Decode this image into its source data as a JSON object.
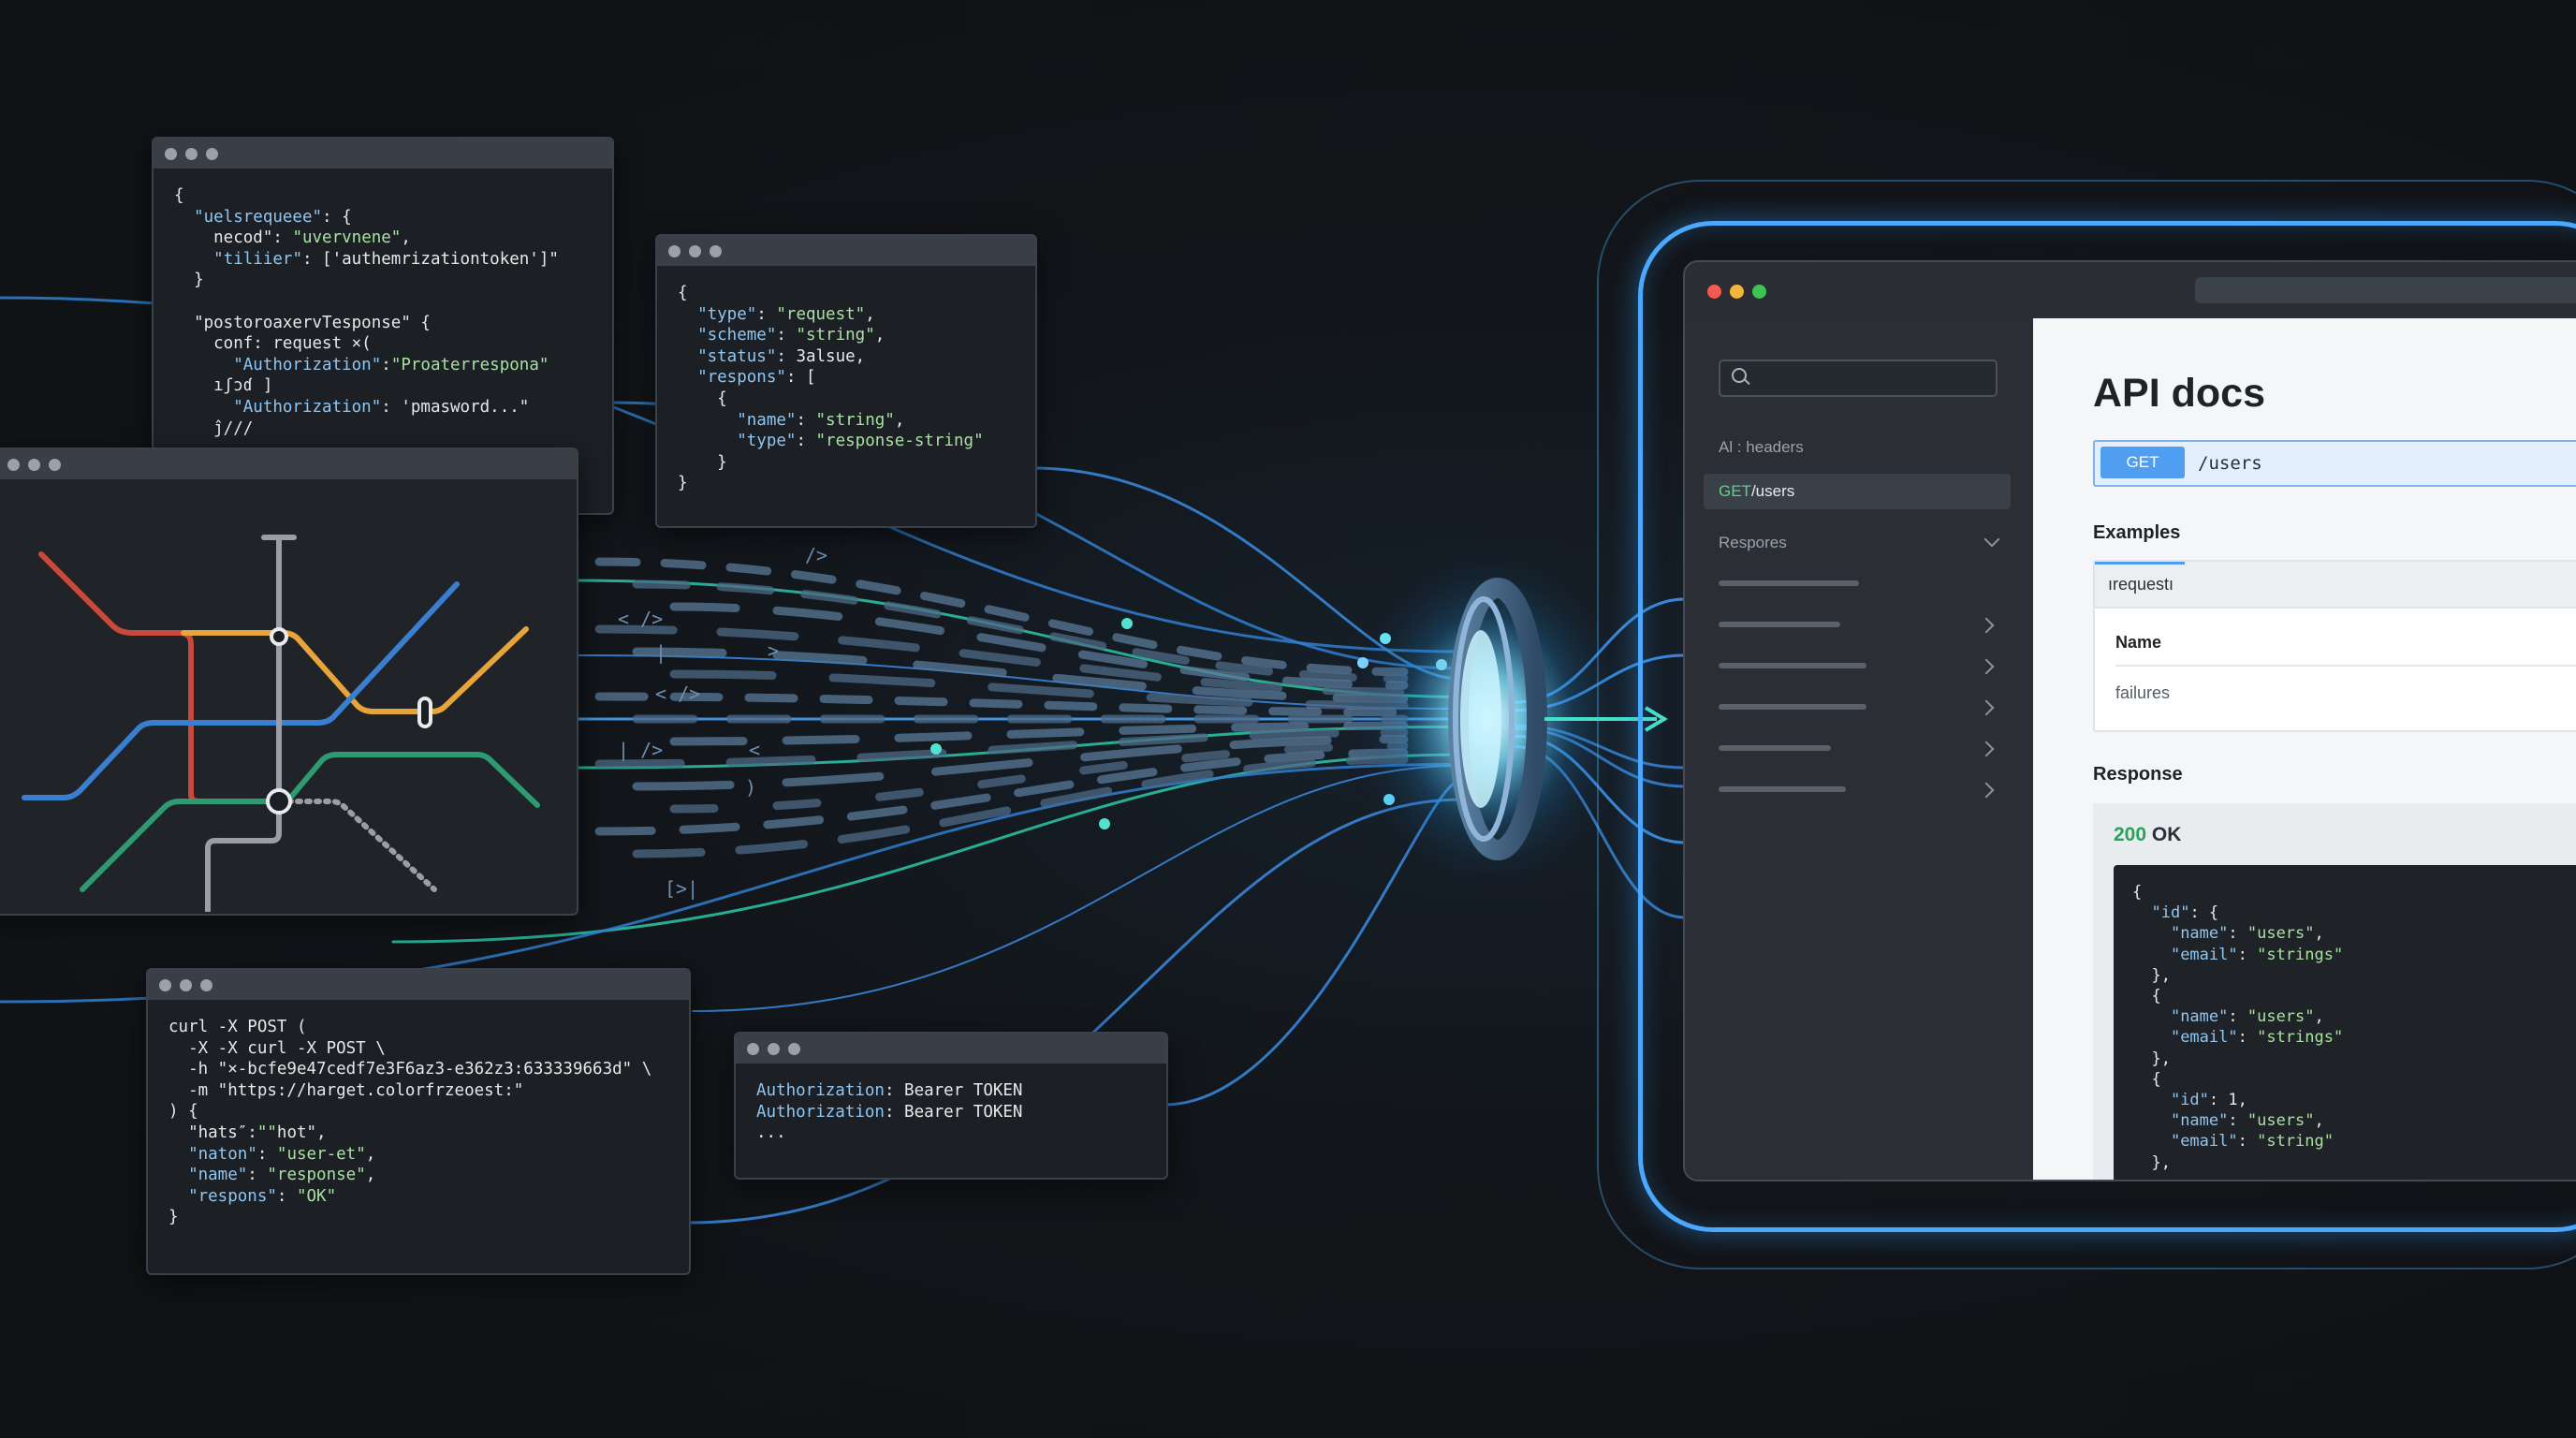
{
  "code_windows": {
    "request_json": [
      "{",
      "  \"uelsrequeee\": {",
      "    necod\": \"uvervnene\",",
      "    \"tiliier\": ['authemrizationtoken']\"",
      "  }",
      "",
      "  \"postoroaxervTesponse\" {",
      "    conf: request ×(",
      "      \"Authorization\":\"Proaterrespona\"",
      "    ıʃɔɗ ]",
      "      \"Authorization\": 'pmasword...\"",
      "    ĵ///"
    ],
    "type_json": [
      "{",
      "  \"type\": \"request\",",
      "  \"scheme\": \"string\",",
      "  \"status\": 3alsue,",
      "  \"respons\": [",
      "    {",
      "      \"name\": \"string\",",
      "      \"type\": \"response-string\"",
      "    }",
      "}"
    ],
    "curl": [
      "curl -X POST (",
      "  -X -X curl -X POST \\",
      "  -h \"×-bcfe9e47cedf7e3F6az3-e362z3:633339663d\" \\",
      "  -m \"https://harget.colorfrzeoest:\"",
      ") {",
      "  \"hats″:\"\"hot\",",
      "  \"naton\": \"user-et\",",
      "  \"name\": \"response\",",
      "  \"respons\": \"OK\"",
      "}"
    ],
    "auth": [
      "Authorization: Bearer TOKEN",
      "Authorization: Bearer TOKEN",
      "..."
    ]
  },
  "stream_glyphs": [
    "/>",
    "< />",
    "|",
    ">",
    "< />",
    "| />",
    "<",
    ")",
    "[>|"
  ],
  "metro_colors": {
    "red": "#c84a3c",
    "orange": "#e6a43a",
    "blue": "#3a7ed0",
    "green": "#2e9a72",
    "grey": "#9a9ea4"
  },
  "docs": {
    "sidebar": {
      "search_placeholder": "",
      "section_headers": "Al : headers",
      "active_method": "GET",
      "active_path": "/users",
      "responses_label": "Respores"
    },
    "title": "API docs",
    "endpoint": {
      "method": "GET",
      "path": "/users"
    },
    "examples": {
      "heading": "Examples",
      "tab": "ırequestı",
      "name_label": "Name",
      "value": "failures"
    },
    "response": {
      "heading": "Response",
      "status_code": "200",
      "status_text": "OK",
      "body": [
        "{",
        "  \"id\": {",
        "    \"name\": \"users\",",
        "    \"email\": \"strings\"",
        "  },",
        "  {",
        "    \"name\": \"users\",",
        "    \"email\": \"strings\"",
        "  },",
        "  {",
        "    \"id\": 1,",
        "    \"name\": \"users\",",
        "    \"email\": \"string\"",
        "  },"
      ]
    }
  },
  "colors": {
    "accent_blue": "#4aa8ff",
    "accent_teal": "#33d6b8",
    "get_green": "#5fd18c",
    "ok_green": "#25a35a"
  }
}
